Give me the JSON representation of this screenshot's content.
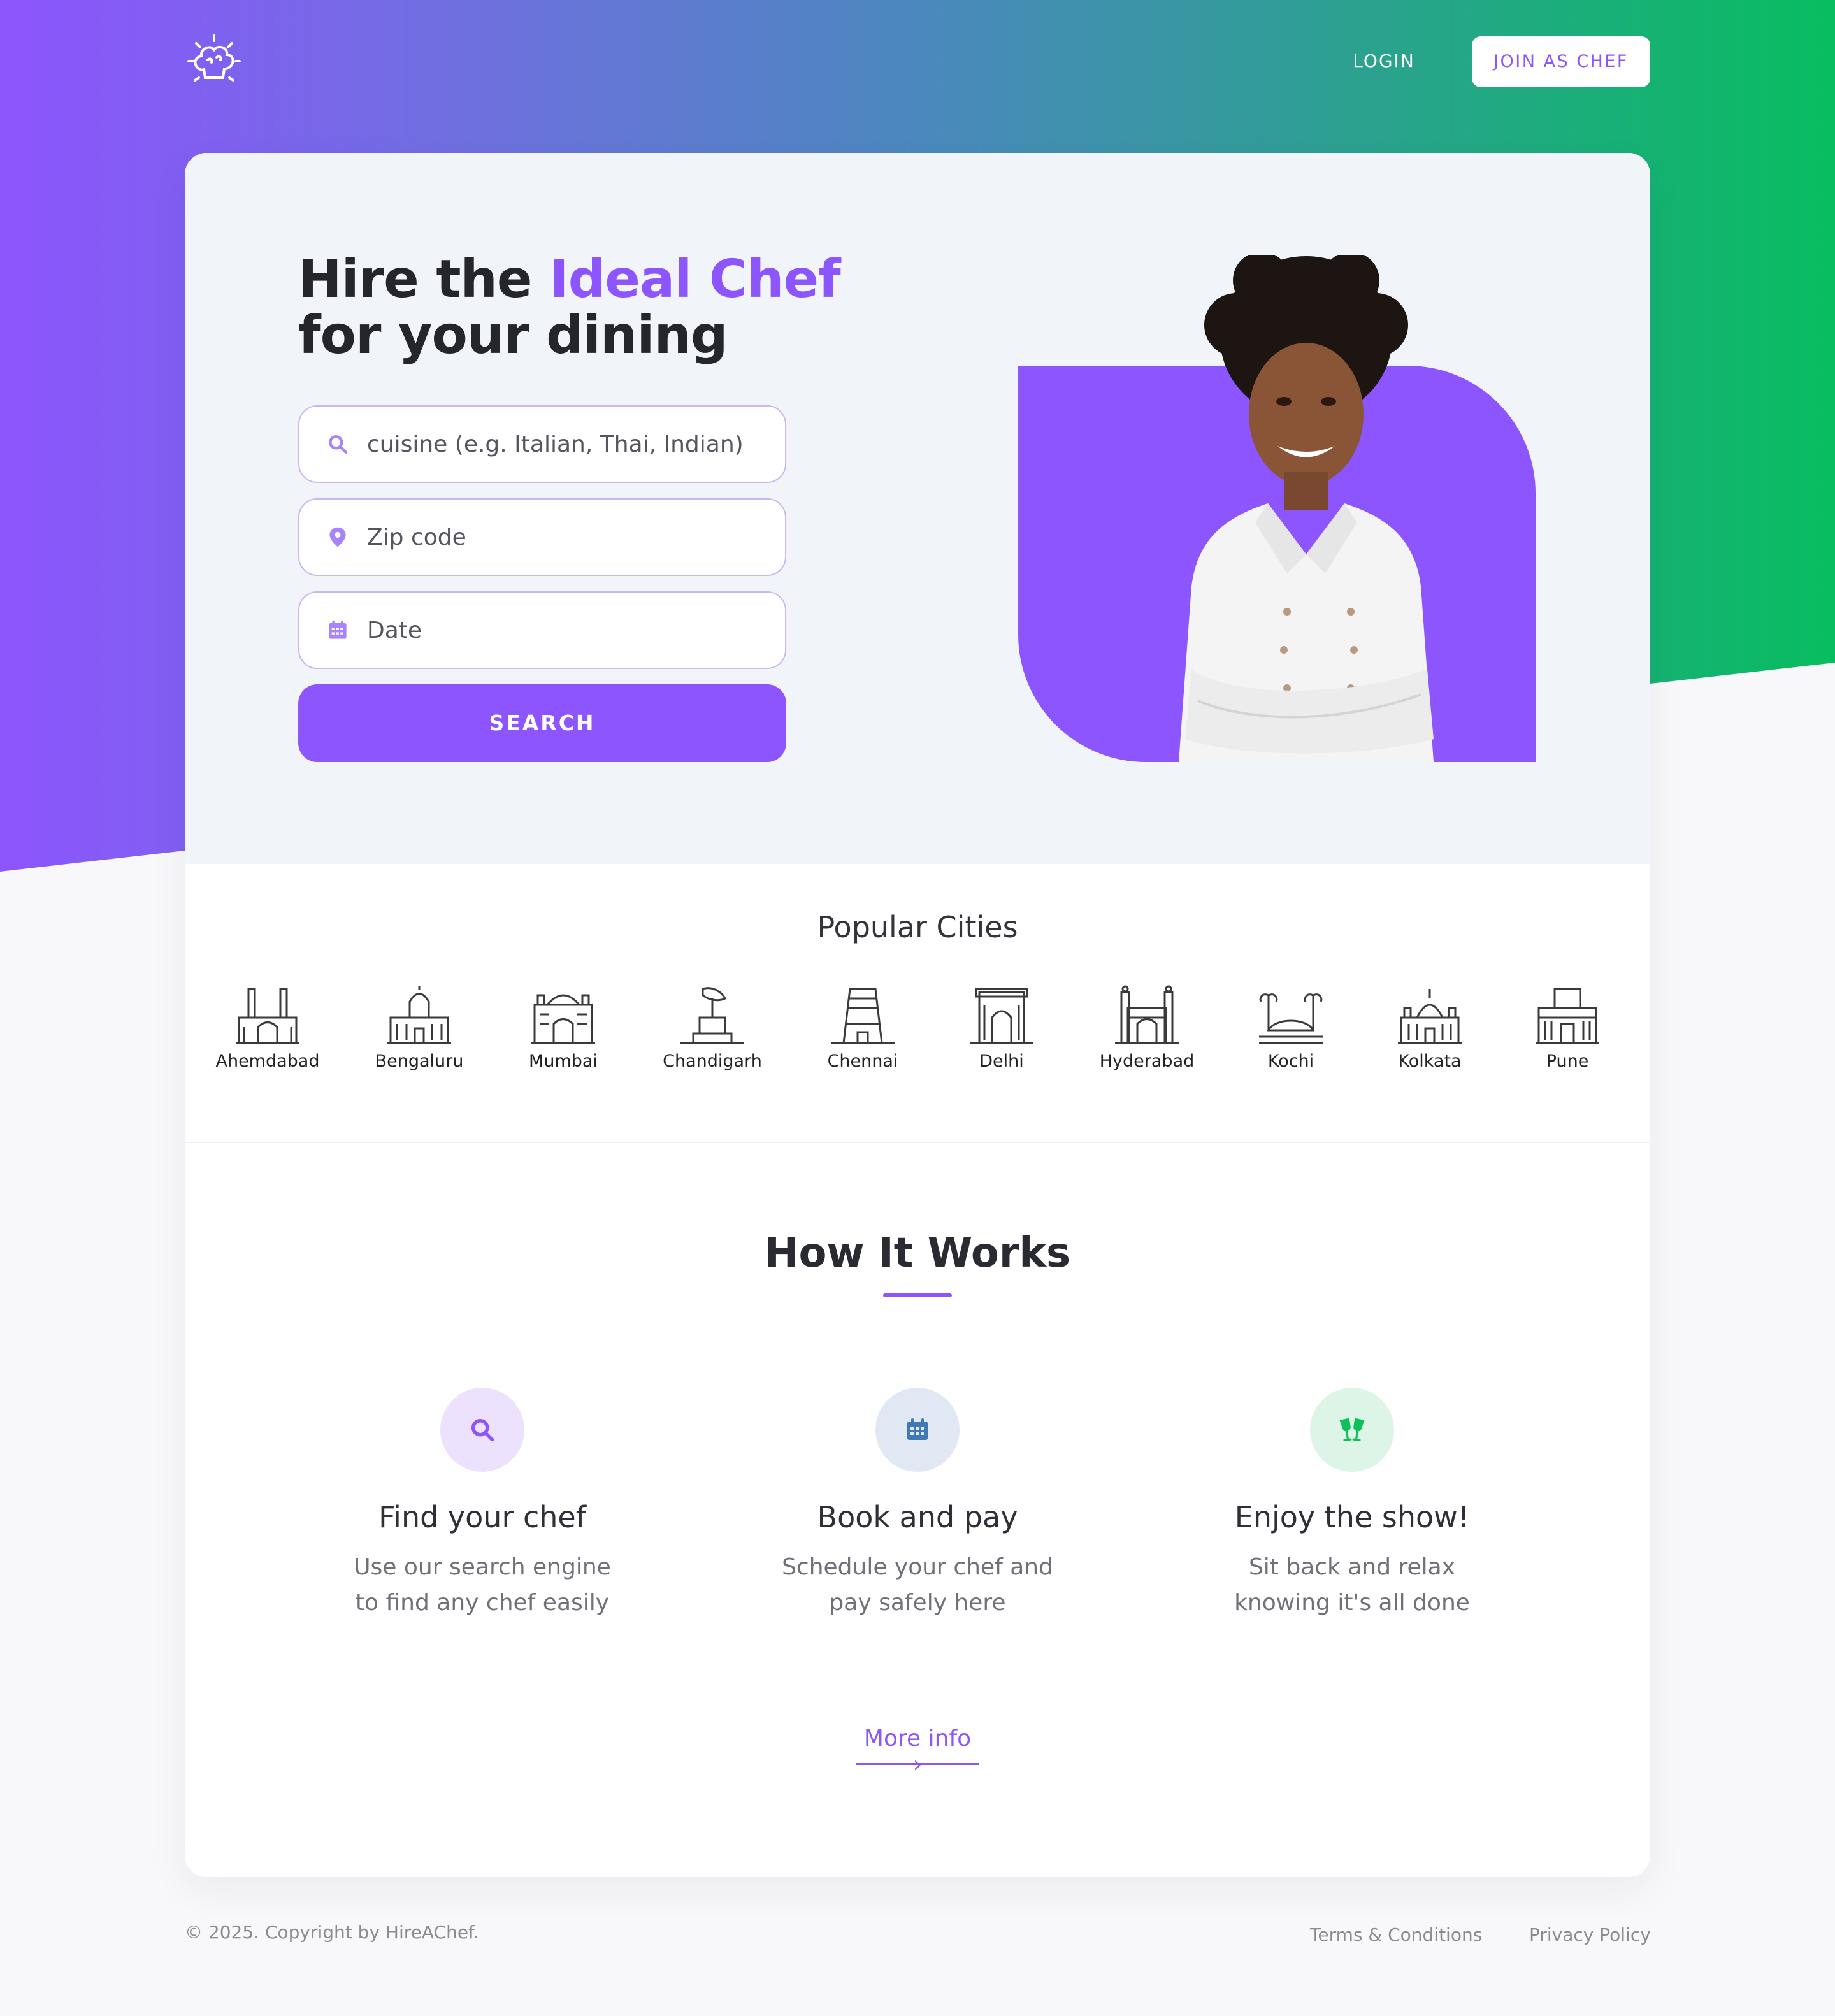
{
  "header": {
    "logo_icon": "chef-hat-logo-icon",
    "login_label": "LOGIN",
    "join_label": "JOIN AS CHEF"
  },
  "hero": {
    "title_part1": "Hire the ",
    "title_accent": "Ideal Chef",
    "title_part2": "for your dining",
    "cuisine_placeholder": "cuisine (e.g. Italian, Thai, Indian)",
    "zip_placeholder": "Zip code",
    "date_placeholder": "Date",
    "search_label": "SEARCH"
  },
  "cities": {
    "title": "Popular Cities",
    "items": [
      {
        "label": "Ahemdabad",
        "icon": "ahmedabad-landmark-icon"
      },
      {
        "label": "Bengaluru",
        "icon": "bengaluru-landmark-icon"
      },
      {
        "label": "Mumbai",
        "icon": "mumbai-landmark-icon"
      },
      {
        "label": "Chandigarh",
        "icon": "chandigarh-landmark-icon"
      },
      {
        "label": "Chennai",
        "icon": "chennai-landmark-icon"
      },
      {
        "label": "Delhi",
        "icon": "delhi-landmark-icon"
      },
      {
        "label": "Hyderabad",
        "icon": "hyderabad-landmark-icon"
      },
      {
        "label": "Kochi",
        "icon": "kochi-landmark-icon"
      },
      {
        "label": "Kolkata",
        "icon": "kolkata-landmark-icon"
      },
      {
        "label": "Pune",
        "icon": "pune-landmark-icon"
      }
    ]
  },
  "how": {
    "title": "How It Works",
    "steps": [
      {
        "title": "Find your chef",
        "line1": "Use our search engine",
        "line2": "to find any chef easily",
        "icon": "search-icon",
        "color": "#8d55fd",
        "bg": "#ece2fe"
      },
      {
        "title": "Book and pay",
        "line1": "Schedule your chef and",
        "line2": "pay safely here",
        "icon": "calendar-icon",
        "color": "#3f7ab5",
        "bg": "#dfe8f3"
      },
      {
        "title": "Enjoy the show!",
        "line1": "Sit back and relax",
        "line2": "knowing it's all done",
        "icon": "cheers-glasses-icon",
        "color": "#0fbf5a",
        "bg": "#dcf5e6"
      }
    ],
    "more_info": "More info ›"
  },
  "footer": {
    "copyright": "© 2025. Copyright by HireAChef.",
    "terms": "Terms & Conditions",
    "privacy": "Privacy Policy"
  },
  "colors": {
    "accent": "#8d55fd",
    "gradient_start": "#8d55fd",
    "gradient_end": "#08bd60"
  }
}
